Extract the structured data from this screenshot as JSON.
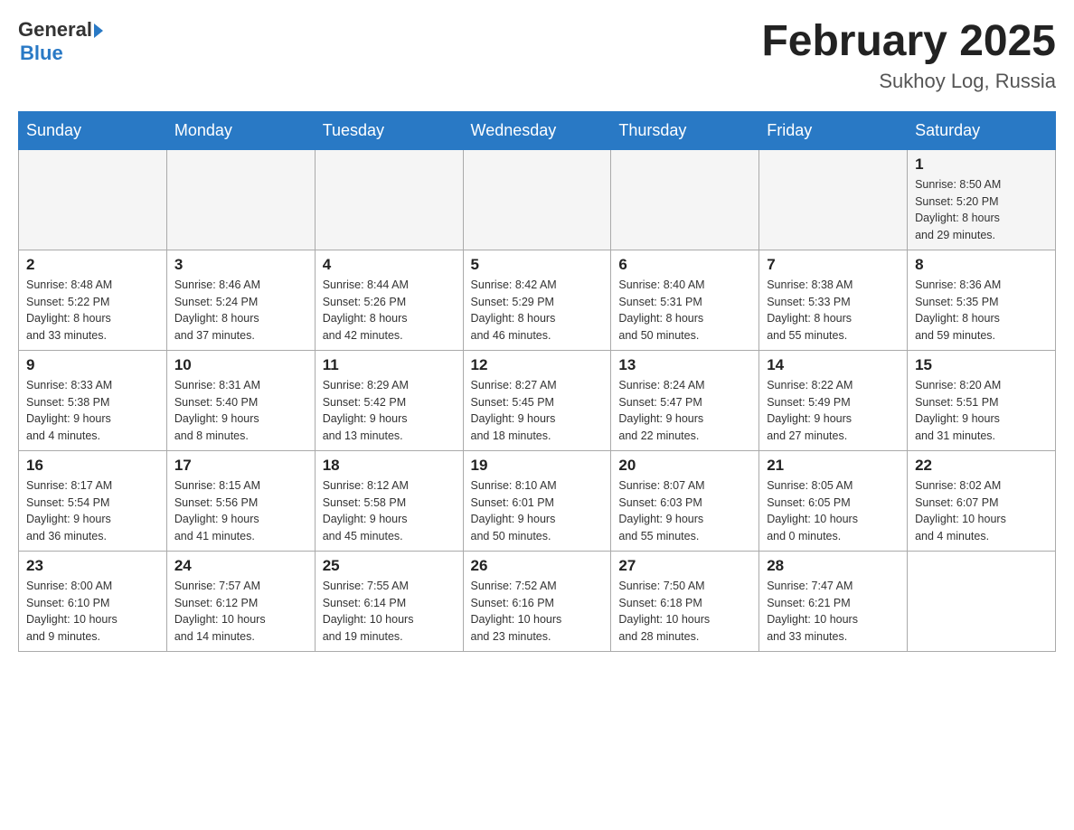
{
  "header": {
    "logo_general": "General",
    "logo_blue": "Blue",
    "month_title": "February 2025",
    "location": "Sukhoy Log, Russia"
  },
  "weekdays": [
    "Sunday",
    "Monday",
    "Tuesday",
    "Wednesday",
    "Thursday",
    "Friday",
    "Saturday"
  ],
  "weeks": [
    [
      {
        "day": "",
        "info": ""
      },
      {
        "day": "",
        "info": ""
      },
      {
        "day": "",
        "info": ""
      },
      {
        "day": "",
        "info": ""
      },
      {
        "day": "",
        "info": ""
      },
      {
        "day": "",
        "info": ""
      },
      {
        "day": "1",
        "info": "Sunrise: 8:50 AM\nSunset: 5:20 PM\nDaylight: 8 hours\nand 29 minutes."
      }
    ],
    [
      {
        "day": "2",
        "info": "Sunrise: 8:48 AM\nSunset: 5:22 PM\nDaylight: 8 hours\nand 33 minutes."
      },
      {
        "day": "3",
        "info": "Sunrise: 8:46 AM\nSunset: 5:24 PM\nDaylight: 8 hours\nand 37 minutes."
      },
      {
        "day": "4",
        "info": "Sunrise: 8:44 AM\nSunset: 5:26 PM\nDaylight: 8 hours\nand 42 minutes."
      },
      {
        "day": "5",
        "info": "Sunrise: 8:42 AM\nSunset: 5:29 PM\nDaylight: 8 hours\nand 46 minutes."
      },
      {
        "day": "6",
        "info": "Sunrise: 8:40 AM\nSunset: 5:31 PM\nDaylight: 8 hours\nand 50 minutes."
      },
      {
        "day": "7",
        "info": "Sunrise: 8:38 AM\nSunset: 5:33 PM\nDaylight: 8 hours\nand 55 minutes."
      },
      {
        "day": "8",
        "info": "Sunrise: 8:36 AM\nSunset: 5:35 PM\nDaylight: 8 hours\nand 59 minutes."
      }
    ],
    [
      {
        "day": "9",
        "info": "Sunrise: 8:33 AM\nSunset: 5:38 PM\nDaylight: 9 hours\nand 4 minutes."
      },
      {
        "day": "10",
        "info": "Sunrise: 8:31 AM\nSunset: 5:40 PM\nDaylight: 9 hours\nand 8 minutes."
      },
      {
        "day": "11",
        "info": "Sunrise: 8:29 AM\nSunset: 5:42 PM\nDaylight: 9 hours\nand 13 minutes."
      },
      {
        "day": "12",
        "info": "Sunrise: 8:27 AM\nSunset: 5:45 PM\nDaylight: 9 hours\nand 18 minutes."
      },
      {
        "day": "13",
        "info": "Sunrise: 8:24 AM\nSunset: 5:47 PM\nDaylight: 9 hours\nand 22 minutes."
      },
      {
        "day": "14",
        "info": "Sunrise: 8:22 AM\nSunset: 5:49 PM\nDaylight: 9 hours\nand 27 minutes."
      },
      {
        "day": "15",
        "info": "Sunrise: 8:20 AM\nSunset: 5:51 PM\nDaylight: 9 hours\nand 31 minutes."
      }
    ],
    [
      {
        "day": "16",
        "info": "Sunrise: 8:17 AM\nSunset: 5:54 PM\nDaylight: 9 hours\nand 36 minutes."
      },
      {
        "day": "17",
        "info": "Sunrise: 8:15 AM\nSunset: 5:56 PM\nDaylight: 9 hours\nand 41 minutes."
      },
      {
        "day": "18",
        "info": "Sunrise: 8:12 AM\nSunset: 5:58 PM\nDaylight: 9 hours\nand 45 minutes."
      },
      {
        "day": "19",
        "info": "Sunrise: 8:10 AM\nSunset: 6:01 PM\nDaylight: 9 hours\nand 50 minutes."
      },
      {
        "day": "20",
        "info": "Sunrise: 8:07 AM\nSunset: 6:03 PM\nDaylight: 9 hours\nand 55 minutes."
      },
      {
        "day": "21",
        "info": "Sunrise: 8:05 AM\nSunset: 6:05 PM\nDaylight: 10 hours\nand 0 minutes."
      },
      {
        "day": "22",
        "info": "Sunrise: 8:02 AM\nSunset: 6:07 PM\nDaylight: 10 hours\nand 4 minutes."
      }
    ],
    [
      {
        "day": "23",
        "info": "Sunrise: 8:00 AM\nSunset: 6:10 PM\nDaylight: 10 hours\nand 9 minutes."
      },
      {
        "day": "24",
        "info": "Sunrise: 7:57 AM\nSunset: 6:12 PM\nDaylight: 10 hours\nand 14 minutes."
      },
      {
        "day": "25",
        "info": "Sunrise: 7:55 AM\nSunset: 6:14 PM\nDaylight: 10 hours\nand 19 minutes."
      },
      {
        "day": "26",
        "info": "Sunrise: 7:52 AM\nSunset: 6:16 PM\nDaylight: 10 hours\nand 23 minutes."
      },
      {
        "day": "27",
        "info": "Sunrise: 7:50 AM\nSunset: 6:18 PM\nDaylight: 10 hours\nand 28 minutes."
      },
      {
        "day": "28",
        "info": "Sunrise: 7:47 AM\nSunset: 6:21 PM\nDaylight: 10 hours\nand 33 minutes."
      },
      {
        "day": "",
        "info": ""
      }
    ]
  ]
}
